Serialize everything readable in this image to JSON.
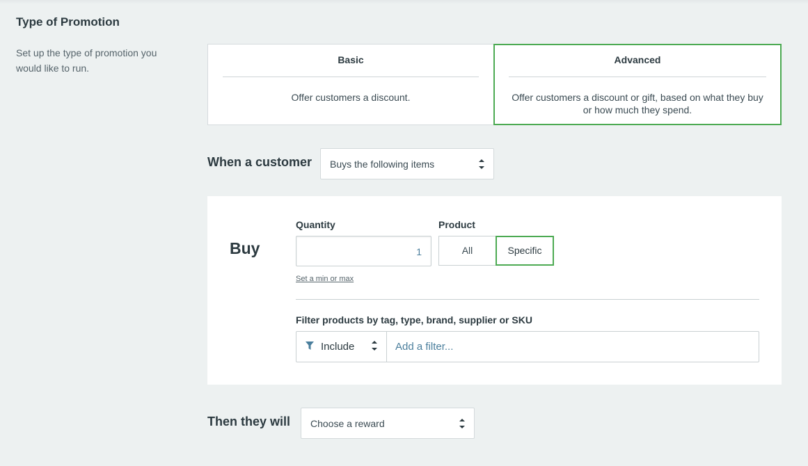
{
  "section": {
    "title": "Type of Promotion",
    "description": "Set up the type of promotion you would like to run."
  },
  "promotion_types": {
    "basic": {
      "title": "Basic",
      "description": "Offer customers a discount."
    },
    "advanced": {
      "title": "Advanced",
      "description": "Offer customers a discount or gift, based on what they buy or how much they spend.",
      "selected": true
    }
  },
  "condition": {
    "label": "When a customer",
    "selected": "Buys the following items"
  },
  "buy": {
    "heading": "Buy",
    "quantity_label": "Quantity",
    "quantity_value": "1",
    "product_label": "Product",
    "product_options": [
      "All",
      "Specific"
    ],
    "product_selected": "Specific",
    "minmax_link": "Set a min or max",
    "filter_label": "Filter products by tag, type, brand, supplier or SKU",
    "filter_mode": "Include",
    "filter_placeholder": "Add a filter..."
  },
  "reward": {
    "label": "Then they will",
    "selected": "Choose a reward"
  },
  "colors": {
    "accent": "#4caa52",
    "link": "#4a7e9c",
    "background": "#edf1f1"
  },
  "icons": [
    "funnel-icon",
    "sort-arrows-icon"
  ]
}
